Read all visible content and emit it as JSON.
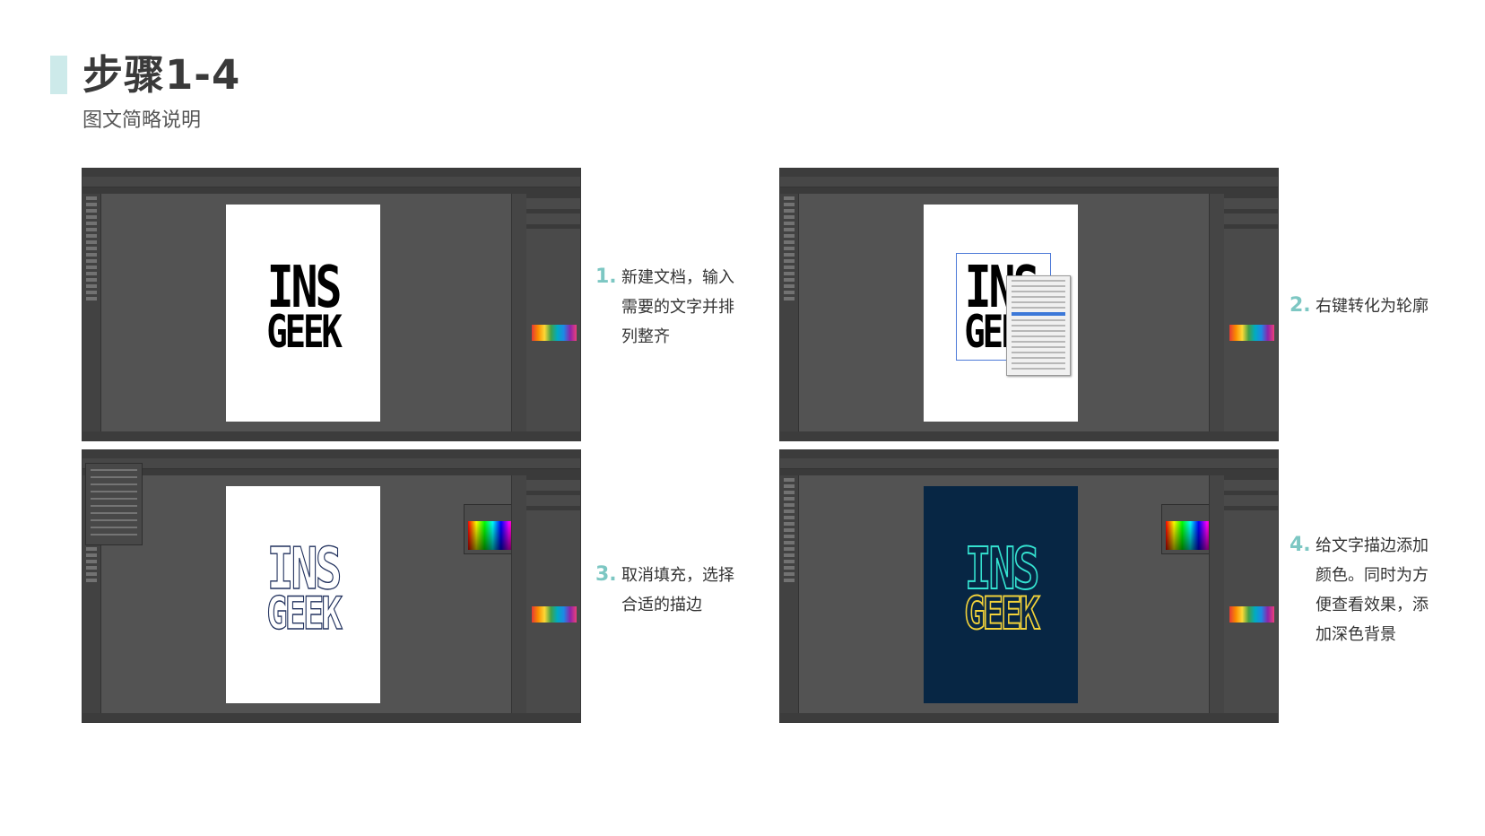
{
  "header": {
    "title": "步骤1-4",
    "subtitle": "图文简略说明"
  },
  "artwork": {
    "line1": "INS",
    "line2": "GEEK"
  },
  "steps": [
    {
      "number": "1.",
      "lines": [
        "新建文档，输入",
        "需要的文字并排",
        "列整齐"
      ]
    },
    {
      "number": "2.",
      "lines": [
        "右键转化为轮廓"
      ]
    },
    {
      "number": "3.",
      "lines": [
        "取消填充，选择",
        "合适的描边"
      ]
    },
    {
      "number": "4.",
      "lines": [
        "给文字描边添加",
        "颜色。同时为方",
        "便查看效果，添",
        "加深色背景"
      ]
    }
  ],
  "colors": {
    "accent_bar": "#cdeaea",
    "step_number": "#7dc7c3",
    "dark_background": "#072644",
    "neon_cyan": "#34e2d0",
    "neon_yellow": "#f2d23a",
    "outline_stroke": "#22325e"
  }
}
